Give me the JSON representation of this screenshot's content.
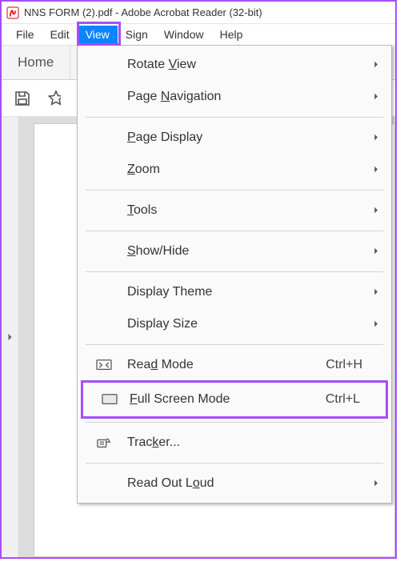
{
  "title": "NNS FORM (2).pdf - Adobe Acrobat Reader (32-bit)",
  "menubar": {
    "file": "File",
    "edit": "Edit",
    "view": "View",
    "sign": "Sign",
    "window": "Window",
    "help": "Help"
  },
  "tabs": {
    "home": "Home"
  },
  "dropdown": {
    "rotate_view": "Rotate View",
    "page_navigation": "Page Navigation",
    "page_display": "Page Display",
    "zoom": "Zoom",
    "tools": "Tools",
    "show_hide": "Show/Hide",
    "display_theme": "Display Theme",
    "display_size": "Display Size",
    "read_mode": "Read Mode",
    "read_mode_shortcut": "Ctrl+H",
    "full_screen_mode": "Full Screen Mode",
    "full_screen_mode_shortcut": "Ctrl+L",
    "tracker": "Tracker...",
    "read_out_loud": "Read Out Loud"
  }
}
